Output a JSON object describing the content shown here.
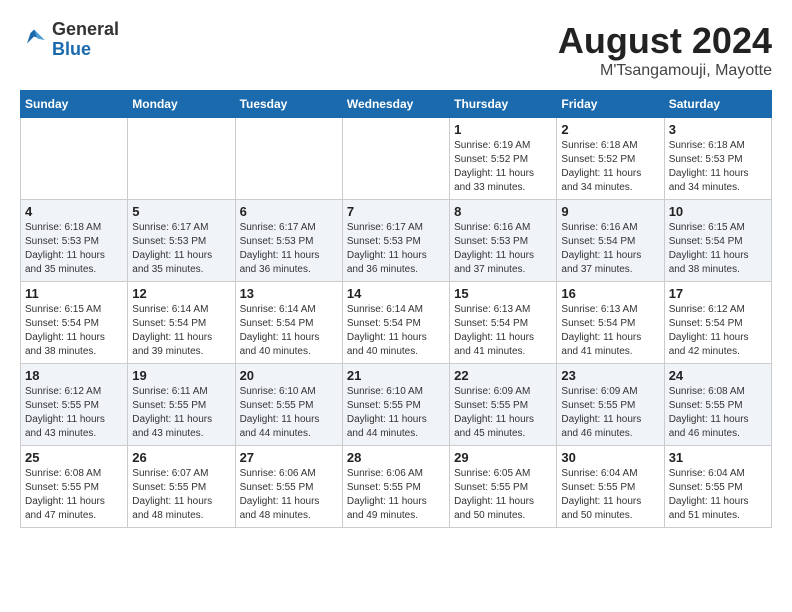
{
  "header": {
    "logo_general": "General",
    "logo_blue": "Blue",
    "title": "August 2024",
    "location": "M'Tsangamouji, Mayotte"
  },
  "days_of_week": [
    "Sunday",
    "Monday",
    "Tuesday",
    "Wednesday",
    "Thursday",
    "Friday",
    "Saturday"
  ],
  "weeks": [
    [
      {
        "day": "",
        "info": ""
      },
      {
        "day": "",
        "info": ""
      },
      {
        "day": "",
        "info": ""
      },
      {
        "day": "",
        "info": ""
      },
      {
        "day": "1",
        "info": "Sunrise: 6:19 AM\nSunset: 5:52 PM\nDaylight: 11 hours\nand 33 minutes."
      },
      {
        "day": "2",
        "info": "Sunrise: 6:18 AM\nSunset: 5:52 PM\nDaylight: 11 hours\nand 34 minutes."
      },
      {
        "day": "3",
        "info": "Sunrise: 6:18 AM\nSunset: 5:53 PM\nDaylight: 11 hours\nand 34 minutes."
      }
    ],
    [
      {
        "day": "4",
        "info": "Sunrise: 6:18 AM\nSunset: 5:53 PM\nDaylight: 11 hours\nand 35 minutes."
      },
      {
        "day": "5",
        "info": "Sunrise: 6:17 AM\nSunset: 5:53 PM\nDaylight: 11 hours\nand 35 minutes."
      },
      {
        "day": "6",
        "info": "Sunrise: 6:17 AM\nSunset: 5:53 PM\nDaylight: 11 hours\nand 36 minutes."
      },
      {
        "day": "7",
        "info": "Sunrise: 6:17 AM\nSunset: 5:53 PM\nDaylight: 11 hours\nand 36 minutes."
      },
      {
        "day": "8",
        "info": "Sunrise: 6:16 AM\nSunset: 5:53 PM\nDaylight: 11 hours\nand 37 minutes."
      },
      {
        "day": "9",
        "info": "Sunrise: 6:16 AM\nSunset: 5:54 PM\nDaylight: 11 hours\nand 37 minutes."
      },
      {
        "day": "10",
        "info": "Sunrise: 6:15 AM\nSunset: 5:54 PM\nDaylight: 11 hours\nand 38 minutes."
      }
    ],
    [
      {
        "day": "11",
        "info": "Sunrise: 6:15 AM\nSunset: 5:54 PM\nDaylight: 11 hours\nand 38 minutes."
      },
      {
        "day": "12",
        "info": "Sunrise: 6:14 AM\nSunset: 5:54 PM\nDaylight: 11 hours\nand 39 minutes."
      },
      {
        "day": "13",
        "info": "Sunrise: 6:14 AM\nSunset: 5:54 PM\nDaylight: 11 hours\nand 40 minutes."
      },
      {
        "day": "14",
        "info": "Sunrise: 6:14 AM\nSunset: 5:54 PM\nDaylight: 11 hours\nand 40 minutes."
      },
      {
        "day": "15",
        "info": "Sunrise: 6:13 AM\nSunset: 5:54 PM\nDaylight: 11 hours\nand 41 minutes."
      },
      {
        "day": "16",
        "info": "Sunrise: 6:13 AM\nSunset: 5:54 PM\nDaylight: 11 hours\nand 41 minutes."
      },
      {
        "day": "17",
        "info": "Sunrise: 6:12 AM\nSunset: 5:54 PM\nDaylight: 11 hours\nand 42 minutes."
      }
    ],
    [
      {
        "day": "18",
        "info": "Sunrise: 6:12 AM\nSunset: 5:55 PM\nDaylight: 11 hours\nand 43 minutes."
      },
      {
        "day": "19",
        "info": "Sunrise: 6:11 AM\nSunset: 5:55 PM\nDaylight: 11 hours\nand 43 minutes."
      },
      {
        "day": "20",
        "info": "Sunrise: 6:10 AM\nSunset: 5:55 PM\nDaylight: 11 hours\nand 44 minutes."
      },
      {
        "day": "21",
        "info": "Sunrise: 6:10 AM\nSunset: 5:55 PM\nDaylight: 11 hours\nand 44 minutes."
      },
      {
        "day": "22",
        "info": "Sunrise: 6:09 AM\nSunset: 5:55 PM\nDaylight: 11 hours\nand 45 minutes."
      },
      {
        "day": "23",
        "info": "Sunrise: 6:09 AM\nSunset: 5:55 PM\nDaylight: 11 hours\nand 46 minutes."
      },
      {
        "day": "24",
        "info": "Sunrise: 6:08 AM\nSunset: 5:55 PM\nDaylight: 11 hours\nand 46 minutes."
      }
    ],
    [
      {
        "day": "25",
        "info": "Sunrise: 6:08 AM\nSunset: 5:55 PM\nDaylight: 11 hours\nand 47 minutes."
      },
      {
        "day": "26",
        "info": "Sunrise: 6:07 AM\nSunset: 5:55 PM\nDaylight: 11 hours\nand 48 minutes."
      },
      {
        "day": "27",
        "info": "Sunrise: 6:06 AM\nSunset: 5:55 PM\nDaylight: 11 hours\nand 48 minutes."
      },
      {
        "day": "28",
        "info": "Sunrise: 6:06 AM\nSunset: 5:55 PM\nDaylight: 11 hours\nand 49 minutes."
      },
      {
        "day": "29",
        "info": "Sunrise: 6:05 AM\nSunset: 5:55 PM\nDaylight: 11 hours\nand 50 minutes."
      },
      {
        "day": "30",
        "info": "Sunrise: 6:04 AM\nSunset: 5:55 PM\nDaylight: 11 hours\nand 50 minutes."
      },
      {
        "day": "31",
        "info": "Sunrise: 6:04 AM\nSunset: 5:55 PM\nDaylight: 11 hours\nand 51 minutes."
      }
    ]
  ]
}
